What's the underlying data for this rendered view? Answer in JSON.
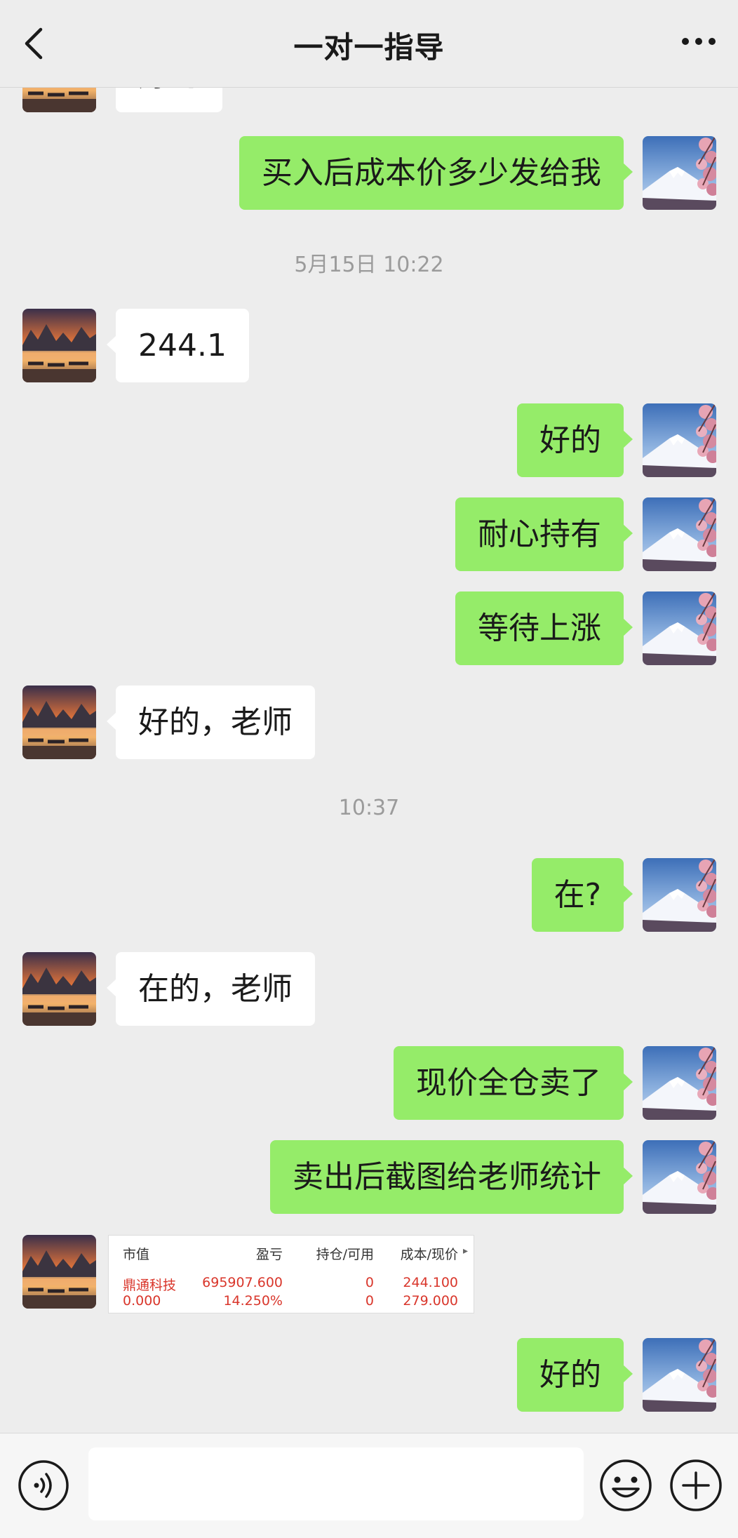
{
  "header": {
    "title": "一对一指导",
    "back_icon": "chevron-left-icon",
    "more_icon": "more-dots-icon"
  },
  "colors": {
    "background": "#ededed",
    "outgoing_bubble": "#95ec69",
    "incoming_bubble": "#ffffff",
    "timestamp": "#9b9b9b",
    "stock_red": "#d9362b"
  },
  "messages": [
    {
      "side": "in",
      "text": "好的",
      "partially_visible": true
    },
    {
      "side": "out",
      "text": "买入后成本价多少发给我"
    },
    {
      "type": "timestamp",
      "text": "5月15日 10:22"
    },
    {
      "side": "in",
      "text": "244.1"
    },
    {
      "side": "out",
      "text": "好的"
    },
    {
      "side": "out",
      "text": "耐心持有"
    },
    {
      "side": "out",
      "text": "等待上涨"
    },
    {
      "side": "in",
      "text": "好的，老师"
    },
    {
      "type": "timestamp",
      "text": "10:37"
    },
    {
      "side": "out",
      "text": "在?"
    },
    {
      "side": "in",
      "text": "在的，老师"
    },
    {
      "side": "out",
      "text": "现价全仓卖了"
    },
    {
      "side": "out",
      "text": "卖出后截图给老师统计"
    },
    {
      "side": "in",
      "type": "image"
    },
    {
      "side": "out",
      "text": "好的"
    }
  ],
  "stock_image": {
    "headers": [
      "市值",
      "盈亏",
      "持仓/可用",
      "成本/现价"
    ],
    "row1": [
      "鼎通科技",
      "695907.600",
      "0",
      "244.100"
    ],
    "row2": [
      "0.000",
      "14.250%",
      "0",
      "279.000"
    ]
  },
  "input_bar": {
    "voice_icon": "voice-icon",
    "emoji_icon": "emoji-icon",
    "plus_icon": "plus-icon",
    "value": ""
  }
}
